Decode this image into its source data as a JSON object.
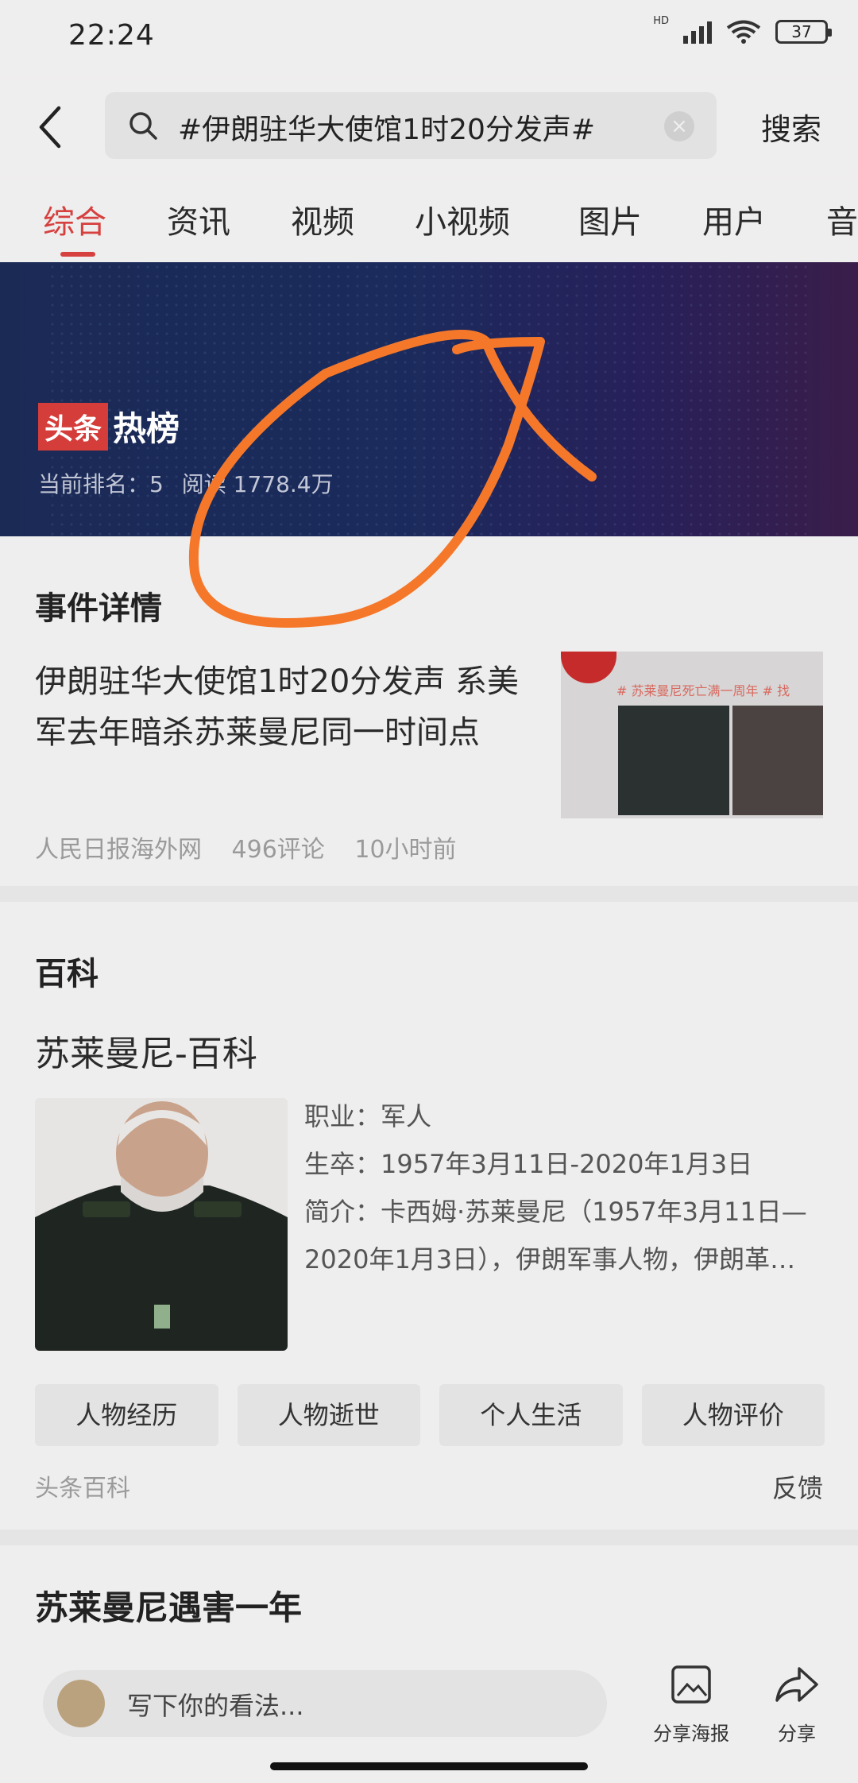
{
  "status_bar": {
    "time": "22:24",
    "network": "HD",
    "battery": "37"
  },
  "search": {
    "query": "#伊朗驻华大使馆1时20分发声#",
    "button": "搜索"
  },
  "tabs": [
    {
      "label": "综合",
      "active": true
    },
    {
      "label": "资讯"
    },
    {
      "label": "视频"
    },
    {
      "label": "小视频"
    },
    {
      "label": "图片"
    },
    {
      "label": "用户"
    },
    {
      "label": "音"
    }
  ],
  "banner": {
    "logo_red": "头条",
    "logo_white": "热榜",
    "rank_text": "当前排名：5",
    "reads_text": "阅读 1778.4万"
  },
  "event": {
    "section_title": "事件详情",
    "title": "伊朗驻华大使馆1时20分发声 系美军去年暗杀苏莱曼尼同一时间点",
    "source": "人民日报海外网",
    "comments": "496评论",
    "time": "10小时前",
    "thumb_caption": "# 苏莱曼尼死亡满一周年 # 找"
  },
  "wiki": {
    "section_title": "百科",
    "name": "苏莱曼尼-百科",
    "occupation": "职业：军人",
    "lifespan": "生卒：1957年3月11日-2020年1月3日",
    "intro_1": "简介：卡西姆·苏莱曼尼（1957年3月11日—",
    "intro_2": "2020年1月3日），伊朗军事人物，伊朗革…",
    "chips": [
      "人物经历",
      "人物逝世",
      "个人生活",
      "人物评价"
    ],
    "source": "头条百科",
    "feedback": "反馈"
  },
  "section3": {
    "title": "苏莱曼尼遇害一年"
  },
  "bottom_bar": {
    "comment_placeholder": "写下你的看法...",
    "share_poster": "分享海报",
    "share": "分享"
  },
  "colors": {
    "accent": "#d6403f",
    "annotation": "#f5782a",
    "banner": "#1b2a55"
  }
}
